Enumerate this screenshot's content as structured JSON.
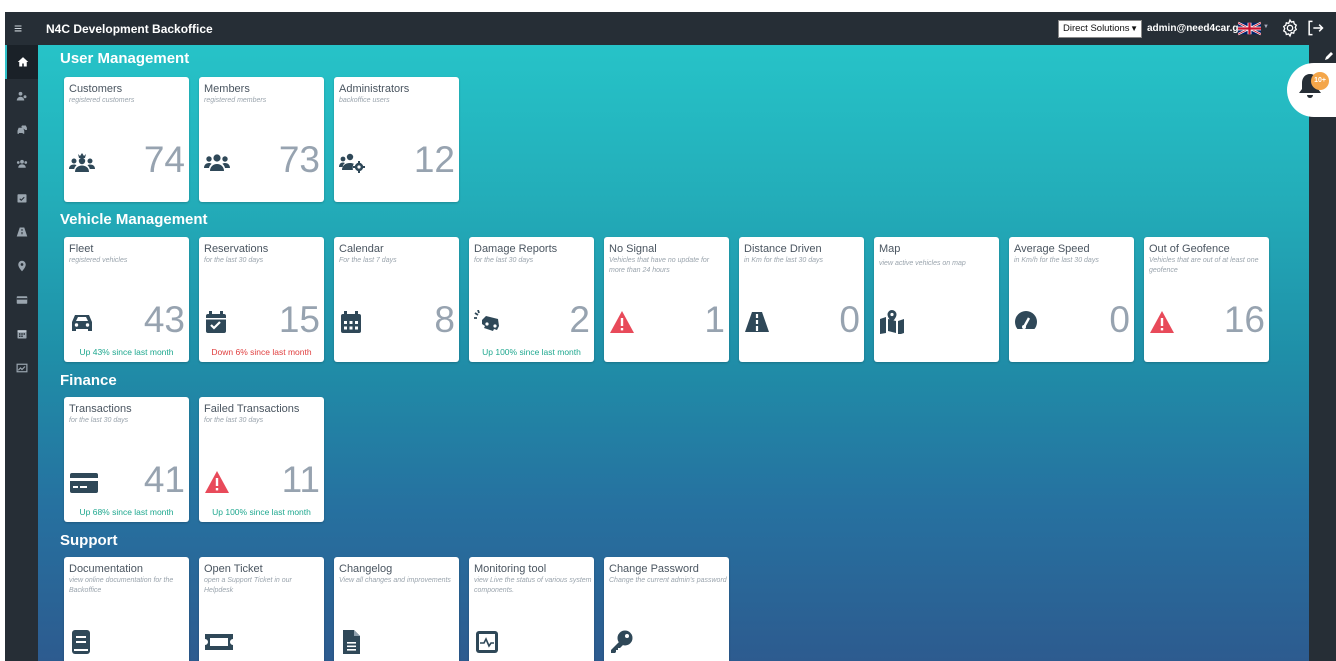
{
  "app_title": "N4C Development Backoffice",
  "topbar": {
    "company": "Direct Solutions",
    "user_email": "admin@need4car.gr"
  },
  "notifications": {
    "badge": "10+"
  },
  "sections": {
    "user_management": "User Management",
    "vehicle_management": "Vehicle Management",
    "finance": "Finance",
    "support": "Support"
  },
  "cards": {
    "customers": {
      "title": "Customers",
      "subtitle": "registered customers",
      "value": "74",
      "icon": "users-crown-icon"
    },
    "members": {
      "title": "Members",
      "subtitle": "registered members",
      "value": "73",
      "icon": "users-icon"
    },
    "administrators": {
      "title": "Administrators",
      "subtitle": "backoffice users",
      "value": "12",
      "icon": "users-cog-icon"
    },
    "fleet": {
      "title": "Fleet",
      "subtitle": "registered vehicles",
      "value": "43",
      "trend": "Up 43% since last month",
      "icon": "car-icon"
    },
    "reservations": {
      "title": "Reservations",
      "subtitle": "for the last 30 days",
      "value": "15",
      "trend": "Down 6% since last month",
      "icon": "calendar-check-icon"
    },
    "calendar": {
      "title": "Calendar",
      "subtitle": "For the last 7 days",
      "value": "8",
      "icon": "calendar-icon"
    },
    "damage_reports": {
      "title": "Damage Reports",
      "subtitle": "for the last 30 days",
      "value": "2",
      "trend": "Up 100% since last month",
      "icon": "car-crash-icon"
    },
    "no_signal": {
      "title": "No Signal",
      "subtitle": "Vehicles that have no update for more than 24 hours",
      "value": "1",
      "icon": "warning-icon"
    },
    "distance_driven": {
      "title": "Distance Driven",
      "subtitle": "in Km for the last 30 days",
      "value": "0",
      "icon": "road-icon"
    },
    "map": {
      "title": "Map",
      "subtitle": "view active vehicles on map",
      "icon": "map-marked-icon"
    },
    "average_speed": {
      "title": "Average Speed",
      "subtitle": "in Km/h for the last 30 days",
      "value": "0",
      "icon": "speedometer-icon"
    },
    "out_of_geofence": {
      "title": "Out of Geofence",
      "subtitle": "Vehicles that are out of at least one geofence",
      "value": "16",
      "icon": "warning-icon"
    },
    "transactions": {
      "title": "Transactions",
      "subtitle": "for the last 30 days",
      "value": "41",
      "trend": "Up 68% since last month",
      "icon": "credit-card-icon"
    },
    "failed_transactions": {
      "title": "Failed Transactions",
      "subtitle": "for the last 30 days",
      "value": "11",
      "trend": "Up 100% since last month",
      "icon": "warning-icon"
    },
    "documentation": {
      "title": "Documentation",
      "subtitle": "view online documentation for the Backoffice",
      "icon": "book-icon"
    },
    "open_ticket": {
      "title": "Open Ticket",
      "subtitle": "open a Support Ticket in our Helpdesk",
      "icon": "ticket-icon"
    },
    "changelog": {
      "title": "Changelog",
      "subtitle": "View all changes and improvements",
      "icon": "file-icon"
    },
    "monitoring_tool": {
      "title": "Monitoring tool",
      "subtitle": "view Live the status of various system components.",
      "icon": "monitor-icon"
    },
    "change_password": {
      "title": "Change Password",
      "subtitle": "Change the current admin's password",
      "icon": "key-icon"
    }
  },
  "colors": {
    "sidebar": "#262e36",
    "icon": "#2f4858",
    "trend_up": "#1fa88f",
    "trend_down": "#e04040",
    "warning": "#e84a5a",
    "badge": "#f4a64a"
  }
}
